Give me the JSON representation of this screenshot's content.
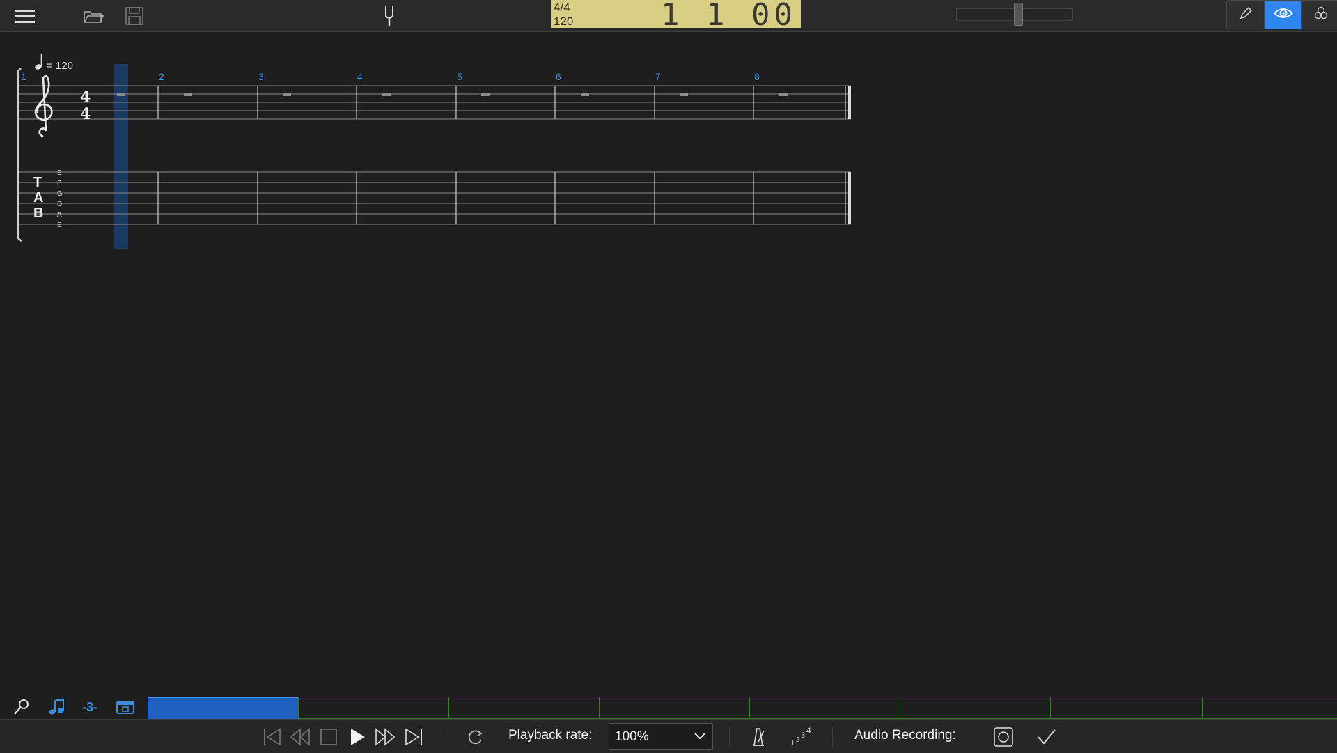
{
  "toolbar": {
    "menu_icon": "hamburger-icon",
    "open_icon": "folder-icon",
    "save_icon": "floppy-disk-icon",
    "tuner_icon": "tuning-fork-icon"
  },
  "lcd": {
    "time_signature": "4/4",
    "tempo": "120",
    "position": "1 1 00"
  },
  "modes": [
    "pencil-icon",
    "eye-icon",
    "cubes-icon"
  ],
  "score": {
    "tempo_marking": "= 120",
    "time_sig_top": "4",
    "time_sig_bottom": "4",
    "measure_numbers": [
      "1",
      "2",
      "3",
      "4",
      "5",
      "6",
      "7",
      "8"
    ],
    "tab_label": [
      "T",
      "A",
      "B"
    ],
    "string_names": [
      "E",
      "B",
      "G",
      "D",
      "A",
      "E"
    ]
  },
  "bottom_strip": {
    "icons": [
      "magnifier-icon",
      "note-icon",
      "triplet-icon",
      "track-view-icon"
    ],
    "triplet_label": "-3-"
  },
  "transport": {
    "playback_rate_label": "Playback rate:",
    "playback_rate_value": "100%",
    "audio_recording_label": "Audio Recording:"
  },
  "colors": {
    "accent": "#2f86f0",
    "lcd_bg": "#d8cf84",
    "measure_number": "#3a8de0",
    "timeline_border": "#3e7a2e"
  }
}
